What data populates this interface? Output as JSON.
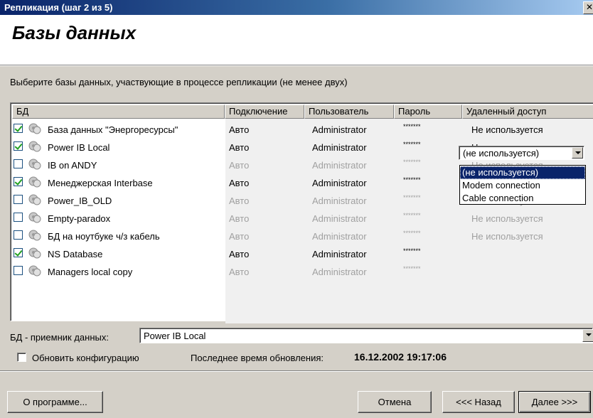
{
  "window": {
    "title": "Репликация (шаг 2 из 5)",
    "close_glyph": "✕"
  },
  "header": {
    "heading": "Базы данных"
  },
  "instruction": "Выберите базы данных, участвующие в процессе репликации (не менее двух)",
  "table": {
    "columns": [
      "БД",
      "Подключение",
      "Пользователь",
      "Пароль",
      "Удаленный доступ"
    ],
    "rows": [
      {
        "checked": true,
        "name": "База данных \"Энергоресурсы\"",
        "connection": "Авто",
        "user": "Administrator",
        "password": "*******",
        "remote": "Не используется"
      },
      {
        "checked": true,
        "name": "Power IB Local",
        "connection": "Авто",
        "user": "Administrator",
        "password": "*******",
        "remote": "Не используется"
      },
      {
        "checked": false,
        "name": "IB on ANDY",
        "connection": "Авто",
        "user": "Administrator",
        "password": "*******",
        "remote": "Не используется"
      },
      {
        "checked": true,
        "name": "Менеджерская Interbase",
        "connection": "Авто",
        "user": "Administrator",
        "password": "*******",
        "remote": "Не используется"
      },
      {
        "checked": false,
        "name": "Power_IB_OLD",
        "connection": "Авто",
        "user": "Administrator",
        "password": "*******",
        "remote": "Не используется"
      },
      {
        "checked": false,
        "name": "Empty-paradox",
        "connection": "Авто",
        "user": "Administrator",
        "password": "*******",
        "remote": "Не используется"
      },
      {
        "checked": false,
        "name": "БД на ноутбуке ч/з кабель",
        "connection": "Авто",
        "user": "Administrator",
        "password": "*******",
        "remote": "Не используется"
      },
      {
        "checked": true,
        "name": "NS Database",
        "connection": "Авто",
        "user": "Administrator",
        "password": "*******",
        "remote": "(не используется)"
      },
      {
        "checked": false,
        "name": "Managers local copy",
        "connection": "Авто",
        "user": "Administrator",
        "password": "*******",
        "remote": ""
      }
    ]
  },
  "remote_combo": {
    "value": "(не используется)",
    "options": [
      "(не используется)",
      "Modem connection",
      "Cable connection"
    ]
  },
  "receiver": {
    "label": "БД - приемник данных:",
    "value": "Power IB Local"
  },
  "update": {
    "label": "Обновить конфигурацию",
    "checked": false,
    "last_label": "Последнее время обновления:",
    "last_value": "16.12.2002 19:17:06"
  },
  "buttons": {
    "about": "О программе...",
    "cancel": "Отмена",
    "back": "<<< Назад",
    "next": "Далее >>>"
  }
}
